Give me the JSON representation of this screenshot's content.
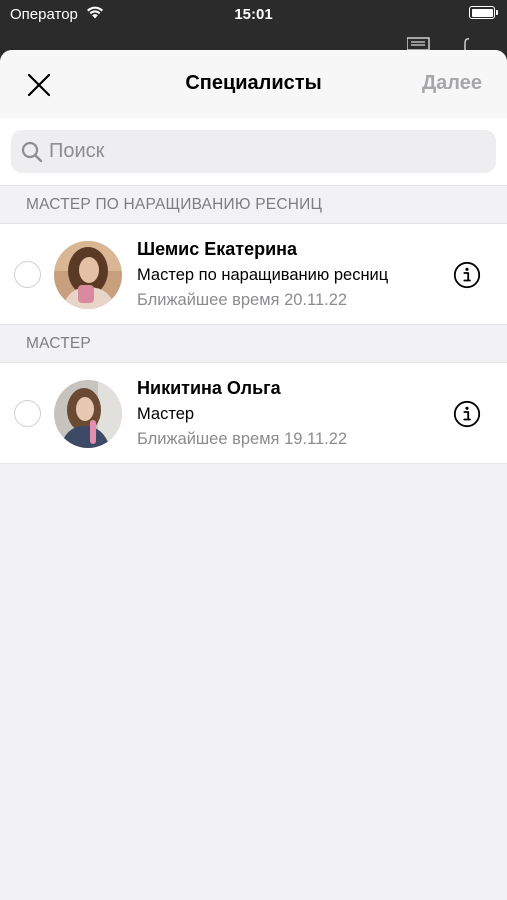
{
  "status_bar": {
    "carrier": "Оператор",
    "time": "15:01"
  },
  "nav": {
    "title": "Специалисты",
    "next_label": "Далее"
  },
  "search": {
    "placeholder": "Поиск"
  },
  "sections": [
    {
      "header": "МАСТЕР ПО НАРАЩИВАНИЮ РЕСНИЦ",
      "items": [
        {
          "name": "Шемис Екатерина",
          "role": "Мастер по наращиванию ресниц",
          "nearest": "Ближайшее время 20.11.22",
          "selected": false
        }
      ]
    },
    {
      "header": "МАСТЕР",
      "items": [
        {
          "name": "Никитина Ольга",
          "role": "Мастер",
          "nearest": "Ближайшее время 19.11.22",
          "selected": false
        }
      ]
    }
  ],
  "icons": {
    "close": "close-icon",
    "search": "search-icon",
    "info": "info-icon",
    "wifi": "wifi-icon",
    "battery": "battery-icon"
  },
  "colors": {
    "sheet_bg": "#f2f2f4",
    "disabled_action": "#a7a7ab",
    "secondary_text": "#8b8b90"
  }
}
